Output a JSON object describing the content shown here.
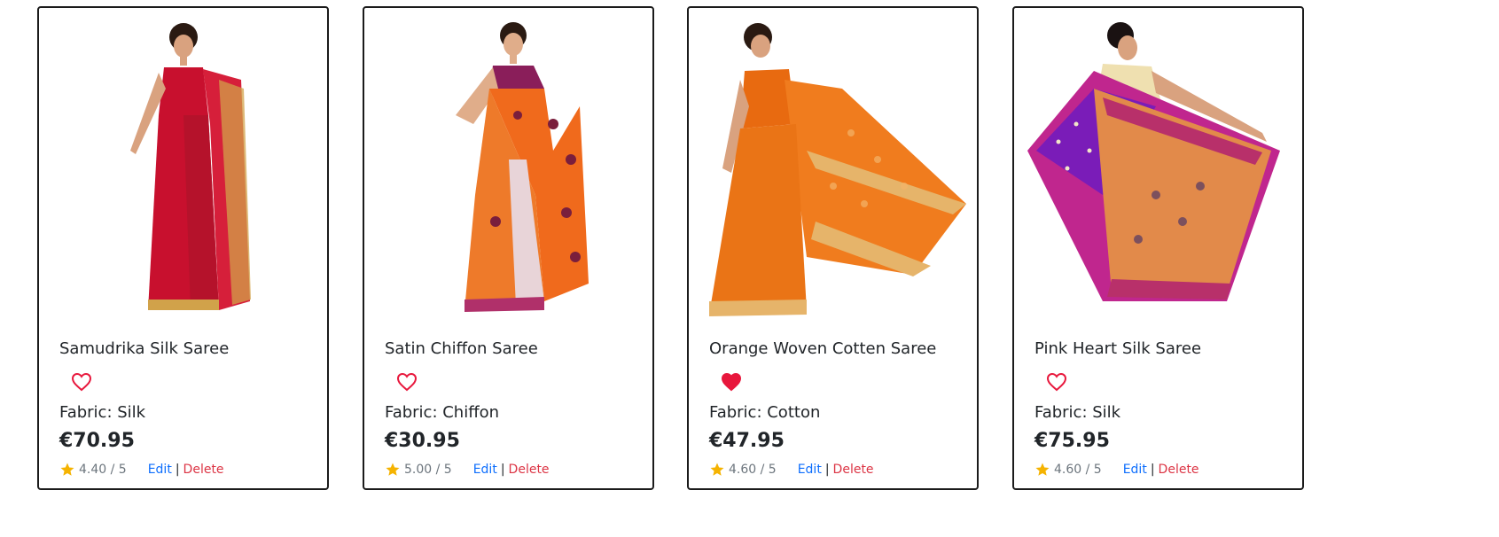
{
  "products": [
    {
      "name": "Samudrika Silk Saree",
      "fabric": "Fabric: Silk",
      "price": "€70.95",
      "rating": "4.40 / 5",
      "favorite": false,
      "edit_label": "Edit",
      "separator": "|",
      "delete_label": "Delete",
      "image_icon": "saree-image-red"
    },
    {
      "name": "Satin Chiffon Saree",
      "fabric": "Fabric: Chiffon",
      "price": "€30.95",
      "rating": "5.00 / 5",
      "favorite": false,
      "edit_label": "Edit",
      "separator": "|",
      "delete_label": "Delete",
      "image_icon": "saree-image-orange-print"
    },
    {
      "name": "Orange Woven Cotten Saree",
      "fabric": "Fabric: Cotton",
      "price": "€47.95",
      "rating": "4.60 / 5",
      "favorite": true,
      "edit_label": "Edit",
      "separator": "|",
      "delete_label": "Delete",
      "image_icon": "saree-image-orange"
    },
    {
      "name": "Pink Heart Silk Saree",
      "fabric": "Fabric: Silk",
      "price": "€75.95",
      "rating": "4.60 / 5",
      "favorite": false,
      "edit_label": "Edit",
      "separator": "|",
      "delete_label": "Delete",
      "image_icon": "saree-image-purple"
    }
  ],
  "colors": {
    "heart": "#e8173c",
    "star": "#f5b301",
    "edit_link": "#0d6efd",
    "delete_link": "#dc3545",
    "card_border": "#1b1b1b"
  }
}
